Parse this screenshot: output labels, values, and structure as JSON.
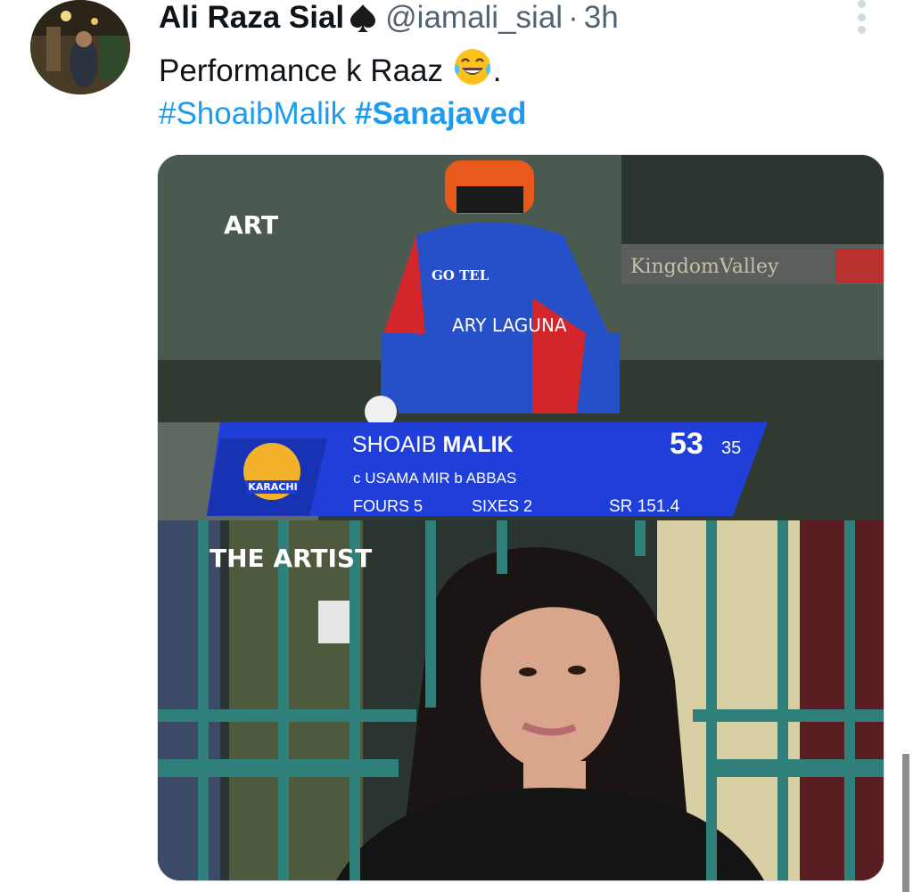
{
  "tweet": {
    "author_name": "Ali Raza Sial",
    "handle": "@iamali_sial",
    "separator": "·",
    "time": "3h",
    "text": "Performance k Raaz",
    "text_suffix": ".",
    "emoji": "face-with-tears-of-joy-emoji",
    "hashtags": [
      "#ShoaibMalik",
      "#Sanajaved"
    ]
  },
  "media": {
    "label_top": "ART",
    "label_bottom": "THE ARTIST",
    "jersey_sponsor": "GO TEL",
    "jersey_logo": "ARY LAGUNA",
    "board_text": "KingdomValley",
    "team_logo": "KARACHI",
    "scorebug": {
      "player_first": "SHOAIB",
      "player_last": "MALIK",
      "runs": "53",
      "balls": "35",
      "dismissal": "c USAMA MIR  b ABBAS",
      "fours_label": "FOURS",
      "fours": "5",
      "sixes_label": "SIXES",
      "sixes": "2",
      "sr_label": "SR",
      "sr": "151.4"
    }
  },
  "colors": {
    "link": "#1d9bf0",
    "text": "#0f1419",
    "muted": "#536471",
    "scorebug_blue": "#1f3fd8"
  }
}
